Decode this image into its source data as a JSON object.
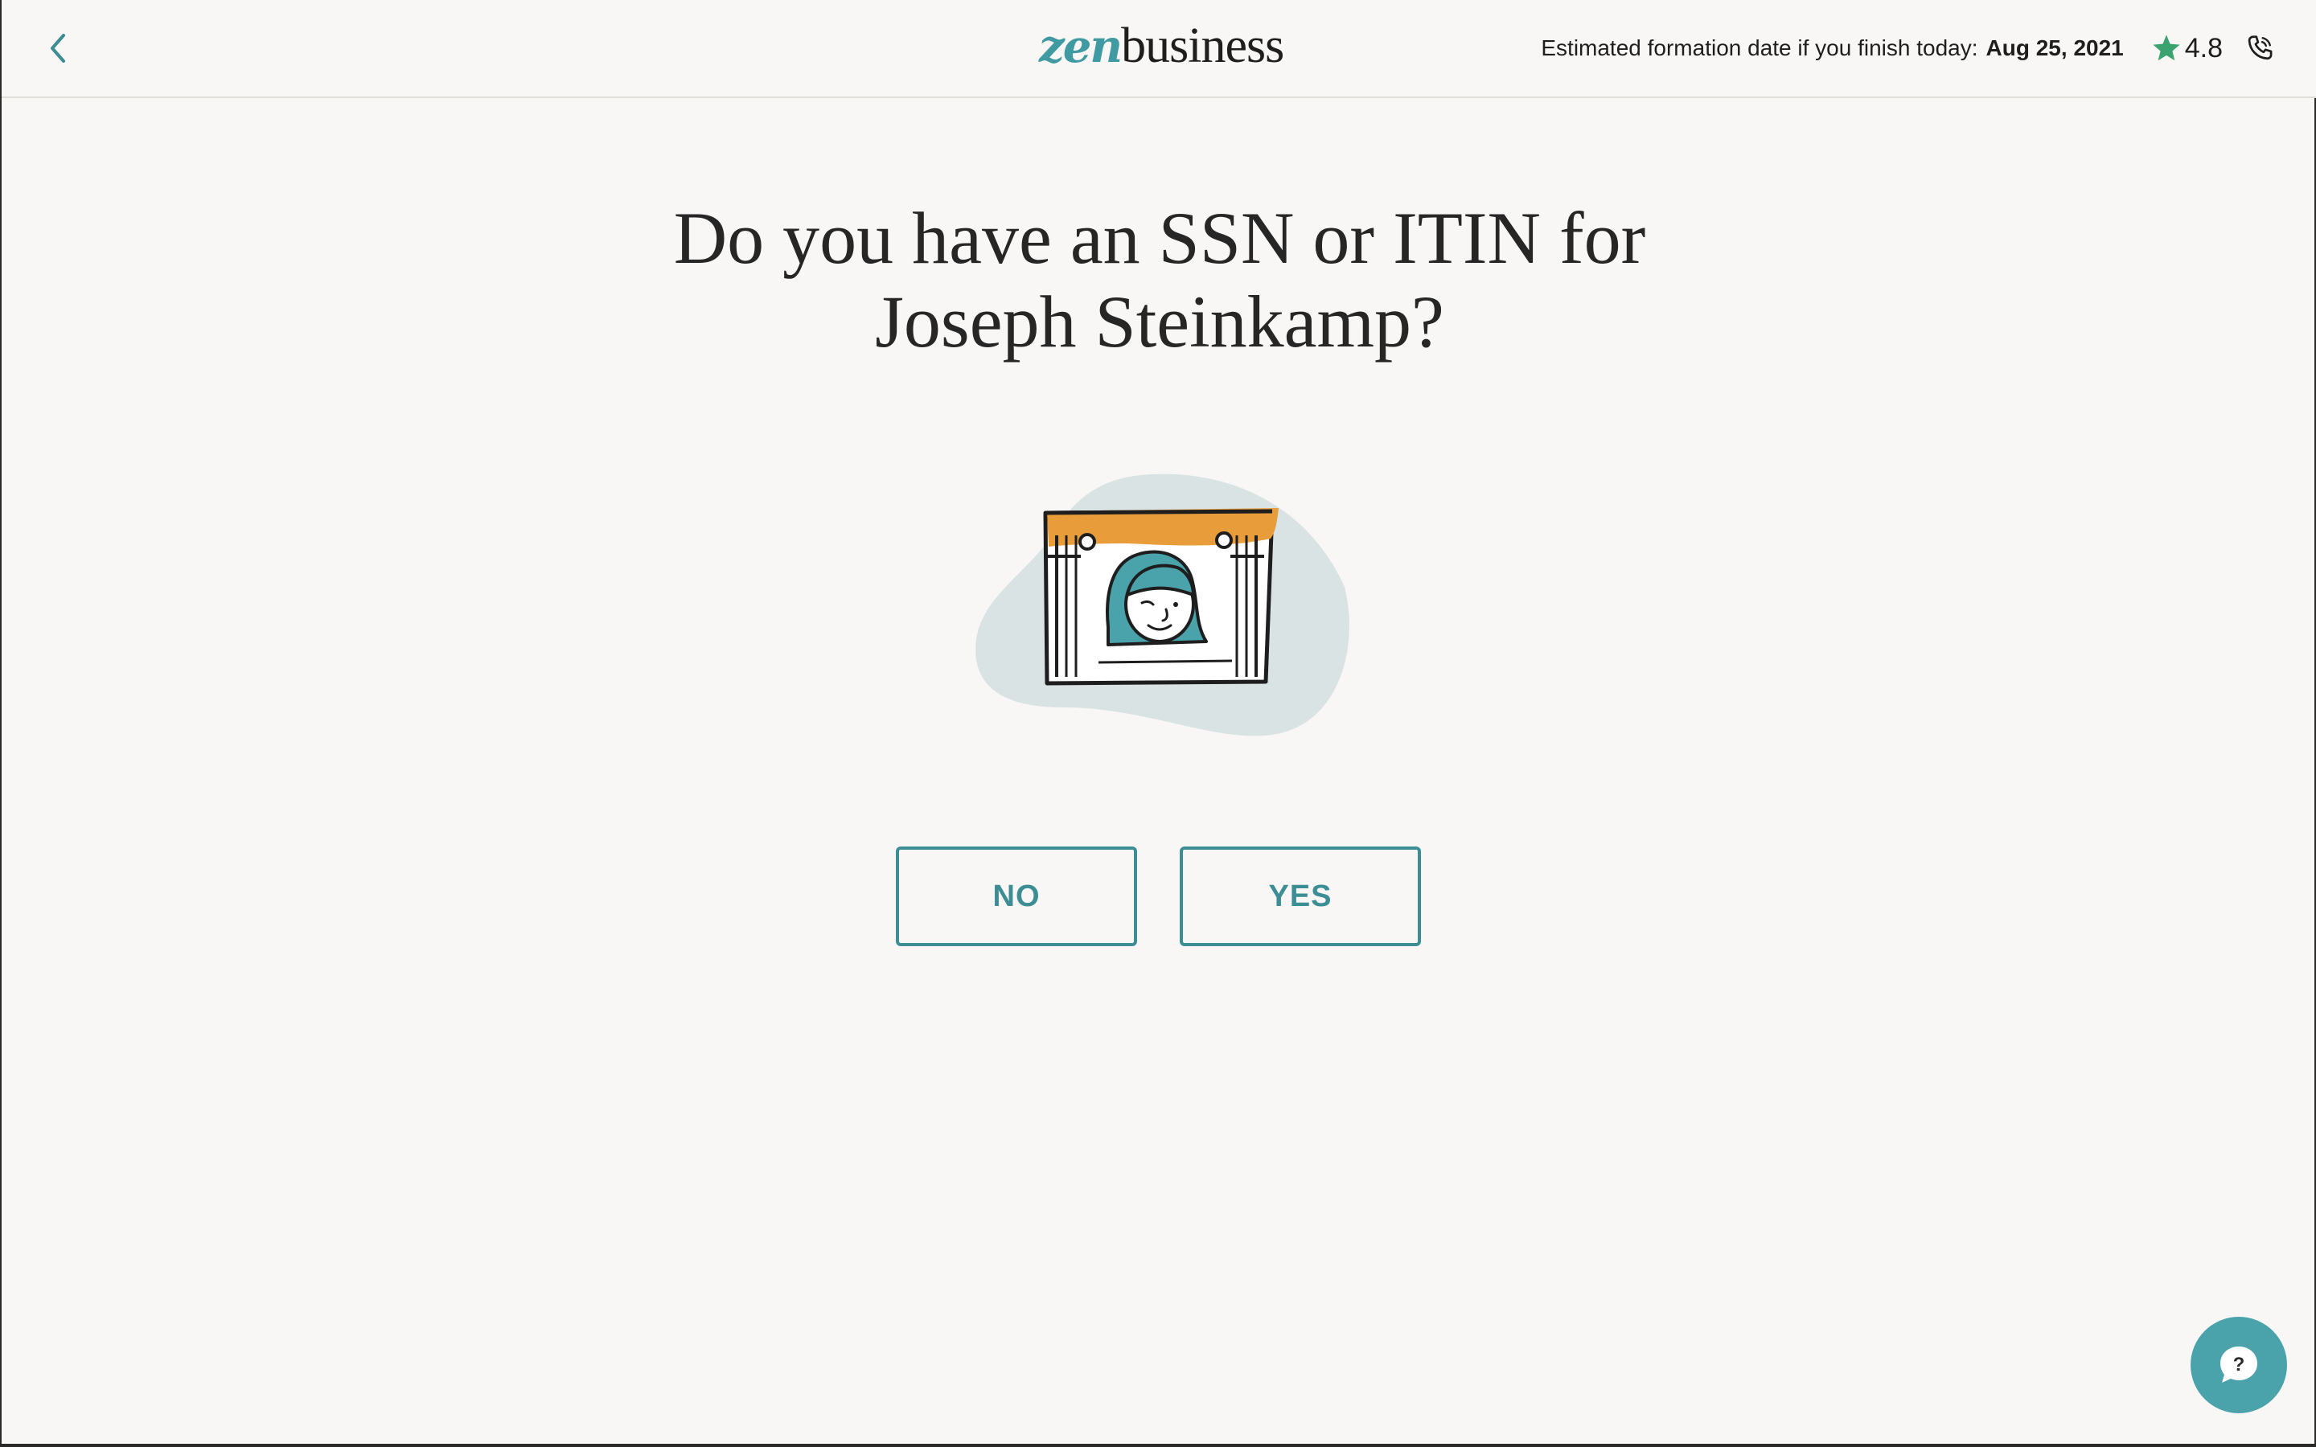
{
  "header": {
    "back_icon": "chevron-left-icon",
    "logo": {
      "zen": "zen",
      "business": "business"
    },
    "eta_label": "Estimated formation date if you finish today:",
    "eta_date": "Aug 25, 2021",
    "rating_value": "4.8",
    "rating_icon": "star-icon",
    "phone_icon": "phone-icon"
  },
  "main": {
    "question_line1": "Do you have an SSN or ITIN for",
    "question_line2": "Joseph Steinkamp?",
    "illustration_icon": "id-card-illustration",
    "buttons": [
      {
        "label": "NO"
      },
      {
        "label": "YES"
      }
    ]
  },
  "help": {
    "icon": "chat-help-icon",
    "glyph": "?"
  },
  "colors": {
    "brand_teal": "#3d8e94",
    "star_green": "#3aa36f",
    "accent_orange": "#e89c3a",
    "blob_gray": "#d9e3e3",
    "background": "#f9f7f5"
  }
}
